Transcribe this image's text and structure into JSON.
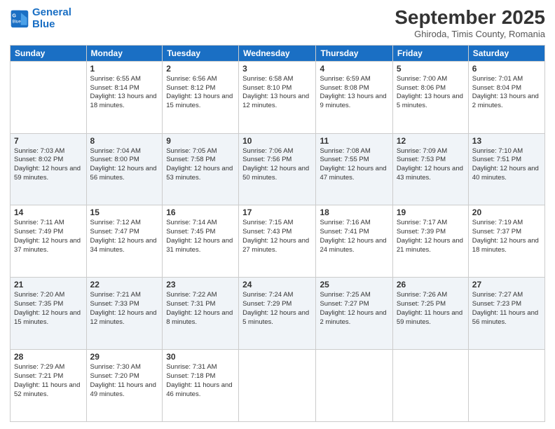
{
  "header": {
    "logo_line1": "General",
    "logo_line2": "Blue",
    "title": "September 2025",
    "subtitle": "Ghiroda, Timis County, Romania"
  },
  "columns": [
    "Sunday",
    "Monday",
    "Tuesday",
    "Wednesday",
    "Thursday",
    "Friday",
    "Saturday"
  ],
  "weeks": [
    {
      "days": [
        {
          "num": "",
          "sunrise": "",
          "sunset": "",
          "daylight": ""
        },
        {
          "num": "1",
          "sunrise": "Sunrise: 6:55 AM",
          "sunset": "Sunset: 8:14 PM",
          "daylight": "Daylight: 13 hours and 18 minutes."
        },
        {
          "num": "2",
          "sunrise": "Sunrise: 6:56 AM",
          "sunset": "Sunset: 8:12 PM",
          "daylight": "Daylight: 13 hours and 15 minutes."
        },
        {
          "num": "3",
          "sunrise": "Sunrise: 6:58 AM",
          "sunset": "Sunset: 8:10 PM",
          "daylight": "Daylight: 13 hours and 12 minutes."
        },
        {
          "num": "4",
          "sunrise": "Sunrise: 6:59 AM",
          "sunset": "Sunset: 8:08 PM",
          "daylight": "Daylight: 13 hours and 9 minutes."
        },
        {
          "num": "5",
          "sunrise": "Sunrise: 7:00 AM",
          "sunset": "Sunset: 8:06 PM",
          "daylight": "Daylight: 13 hours and 5 minutes."
        },
        {
          "num": "6",
          "sunrise": "Sunrise: 7:01 AM",
          "sunset": "Sunset: 8:04 PM",
          "daylight": "Daylight: 13 hours and 2 minutes."
        }
      ]
    },
    {
      "days": [
        {
          "num": "7",
          "sunrise": "Sunrise: 7:03 AM",
          "sunset": "Sunset: 8:02 PM",
          "daylight": "Daylight: 12 hours and 59 minutes."
        },
        {
          "num": "8",
          "sunrise": "Sunrise: 7:04 AM",
          "sunset": "Sunset: 8:00 PM",
          "daylight": "Daylight: 12 hours and 56 minutes."
        },
        {
          "num": "9",
          "sunrise": "Sunrise: 7:05 AM",
          "sunset": "Sunset: 7:58 PM",
          "daylight": "Daylight: 12 hours and 53 minutes."
        },
        {
          "num": "10",
          "sunrise": "Sunrise: 7:06 AM",
          "sunset": "Sunset: 7:56 PM",
          "daylight": "Daylight: 12 hours and 50 minutes."
        },
        {
          "num": "11",
          "sunrise": "Sunrise: 7:08 AM",
          "sunset": "Sunset: 7:55 PM",
          "daylight": "Daylight: 12 hours and 47 minutes."
        },
        {
          "num": "12",
          "sunrise": "Sunrise: 7:09 AM",
          "sunset": "Sunset: 7:53 PM",
          "daylight": "Daylight: 12 hours and 43 minutes."
        },
        {
          "num": "13",
          "sunrise": "Sunrise: 7:10 AM",
          "sunset": "Sunset: 7:51 PM",
          "daylight": "Daylight: 12 hours and 40 minutes."
        }
      ]
    },
    {
      "days": [
        {
          "num": "14",
          "sunrise": "Sunrise: 7:11 AM",
          "sunset": "Sunset: 7:49 PM",
          "daylight": "Daylight: 12 hours and 37 minutes."
        },
        {
          "num": "15",
          "sunrise": "Sunrise: 7:12 AM",
          "sunset": "Sunset: 7:47 PM",
          "daylight": "Daylight: 12 hours and 34 minutes."
        },
        {
          "num": "16",
          "sunrise": "Sunrise: 7:14 AM",
          "sunset": "Sunset: 7:45 PM",
          "daylight": "Daylight: 12 hours and 31 minutes."
        },
        {
          "num": "17",
          "sunrise": "Sunrise: 7:15 AM",
          "sunset": "Sunset: 7:43 PM",
          "daylight": "Daylight: 12 hours and 27 minutes."
        },
        {
          "num": "18",
          "sunrise": "Sunrise: 7:16 AM",
          "sunset": "Sunset: 7:41 PM",
          "daylight": "Daylight: 12 hours and 24 minutes."
        },
        {
          "num": "19",
          "sunrise": "Sunrise: 7:17 AM",
          "sunset": "Sunset: 7:39 PM",
          "daylight": "Daylight: 12 hours and 21 minutes."
        },
        {
          "num": "20",
          "sunrise": "Sunrise: 7:19 AM",
          "sunset": "Sunset: 7:37 PM",
          "daylight": "Daylight: 12 hours and 18 minutes."
        }
      ]
    },
    {
      "days": [
        {
          "num": "21",
          "sunrise": "Sunrise: 7:20 AM",
          "sunset": "Sunset: 7:35 PM",
          "daylight": "Daylight: 12 hours and 15 minutes."
        },
        {
          "num": "22",
          "sunrise": "Sunrise: 7:21 AM",
          "sunset": "Sunset: 7:33 PM",
          "daylight": "Daylight: 12 hours and 12 minutes."
        },
        {
          "num": "23",
          "sunrise": "Sunrise: 7:22 AM",
          "sunset": "Sunset: 7:31 PM",
          "daylight": "Daylight: 12 hours and 8 minutes."
        },
        {
          "num": "24",
          "sunrise": "Sunrise: 7:24 AM",
          "sunset": "Sunset: 7:29 PM",
          "daylight": "Daylight: 12 hours and 5 minutes."
        },
        {
          "num": "25",
          "sunrise": "Sunrise: 7:25 AM",
          "sunset": "Sunset: 7:27 PM",
          "daylight": "Daylight: 12 hours and 2 minutes."
        },
        {
          "num": "26",
          "sunrise": "Sunrise: 7:26 AM",
          "sunset": "Sunset: 7:25 PM",
          "daylight": "Daylight: 11 hours and 59 minutes."
        },
        {
          "num": "27",
          "sunrise": "Sunrise: 7:27 AM",
          "sunset": "Sunset: 7:23 PM",
          "daylight": "Daylight: 11 hours and 56 minutes."
        }
      ]
    },
    {
      "days": [
        {
          "num": "28",
          "sunrise": "Sunrise: 7:29 AM",
          "sunset": "Sunset: 7:21 PM",
          "daylight": "Daylight: 11 hours and 52 minutes."
        },
        {
          "num": "29",
          "sunrise": "Sunrise: 7:30 AM",
          "sunset": "Sunset: 7:20 PM",
          "daylight": "Daylight: 11 hours and 49 minutes."
        },
        {
          "num": "30",
          "sunrise": "Sunrise: 7:31 AM",
          "sunset": "Sunset: 7:18 PM",
          "daylight": "Daylight: 11 hours and 46 minutes."
        },
        {
          "num": "",
          "sunrise": "",
          "sunset": "",
          "daylight": ""
        },
        {
          "num": "",
          "sunrise": "",
          "sunset": "",
          "daylight": ""
        },
        {
          "num": "",
          "sunrise": "",
          "sunset": "",
          "daylight": ""
        },
        {
          "num": "",
          "sunrise": "",
          "sunset": "",
          "daylight": ""
        }
      ]
    }
  ]
}
